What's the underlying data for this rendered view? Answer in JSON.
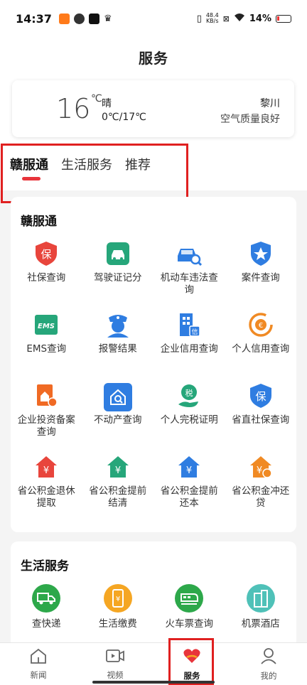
{
  "status": {
    "time": "14:37",
    "net_speed_value": "48.4",
    "net_speed_unit": "KB/s",
    "battery": "14%"
  },
  "header": {
    "title": "服务"
  },
  "weather": {
    "temp": "16",
    "unit": "℃",
    "condition": "晴",
    "range": "0℃/17℃",
    "city": "黎川",
    "air": "空气质量良好"
  },
  "tabs": [
    {
      "label": "赣服通"
    },
    {
      "label": "生活服务"
    },
    {
      "label": "推荐"
    }
  ],
  "gov": {
    "title": "赣服通",
    "items": [
      {
        "label": "社保查询",
        "icon": "shield-bao-icon",
        "color": "#e8453c"
      },
      {
        "label": "驾驶证记分",
        "icon": "car-license-icon",
        "color": "#26a67a"
      },
      {
        "label": "机动车违法查询",
        "icon": "car-search-icon",
        "color": "#2f7de1"
      },
      {
        "label": "案件查询",
        "icon": "police-badge-icon",
        "color": "#2f7de1"
      },
      {
        "label": "EMS查询",
        "icon": "ems-icon",
        "color": "#26a67a"
      },
      {
        "label": "报警结果",
        "icon": "police-officer-icon",
        "color": "#2f7de1"
      },
      {
        "label": "企业信用查询",
        "icon": "enterprise-credit-icon",
        "color": "#2f7de1"
      },
      {
        "label": "个人信用查询",
        "icon": "personal-credit-icon",
        "color": "#f08a24"
      },
      {
        "label": "企业投资备案查询",
        "icon": "investment-icon",
        "color": "#f06a24"
      },
      {
        "label": "不动产查询",
        "icon": "real-estate-icon",
        "color": "#2f7de1"
      },
      {
        "label": "个人完税证明",
        "icon": "tax-icon",
        "color": "#26a67a"
      },
      {
        "label": "省直社保查询",
        "icon": "shield-bao-icon",
        "color": "#2f7de1"
      },
      {
        "label": "省公积金退休提取",
        "icon": "fund-house-icon",
        "color": "#e8453c"
      },
      {
        "label": "省公积金提前结清",
        "icon": "fund-house-icon",
        "color": "#26a67a"
      },
      {
        "label": "省公积金提前还本",
        "icon": "fund-house-icon",
        "color": "#2f7de1"
      },
      {
        "label": "省公积金冲还贷",
        "icon": "fund-house-icon",
        "color": "#f08a24"
      }
    ]
  },
  "life": {
    "title": "生活服务",
    "items": [
      {
        "label": "查快递",
        "icon": "truck-icon",
        "color": "#2da84a"
      },
      {
        "label": "生活缴费",
        "icon": "phone-payment-icon",
        "color": "#f5a623"
      },
      {
        "label": "火车票查询",
        "icon": "train-icon",
        "color": "#2da84a"
      },
      {
        "label": "机票酒店",
        "icon": "building-icon",
        "color": "#4fc1b8"
      }
    ]
  },
  "nav": [
    {
      "label": "新闻",
      "icon": "home-icon"
    },
    {
      "label": "视频",
      "icon": "video-icon"
    },
    {
      "label": "服务",
      "icon": "heart-hand-icon"
    },
    {
      "label": "我的",
      "icon": "user-icon"
    }
  ],
  "colors": {
    "accent": "#e8343b",
    "highlight": "#e02020"
  }
}
